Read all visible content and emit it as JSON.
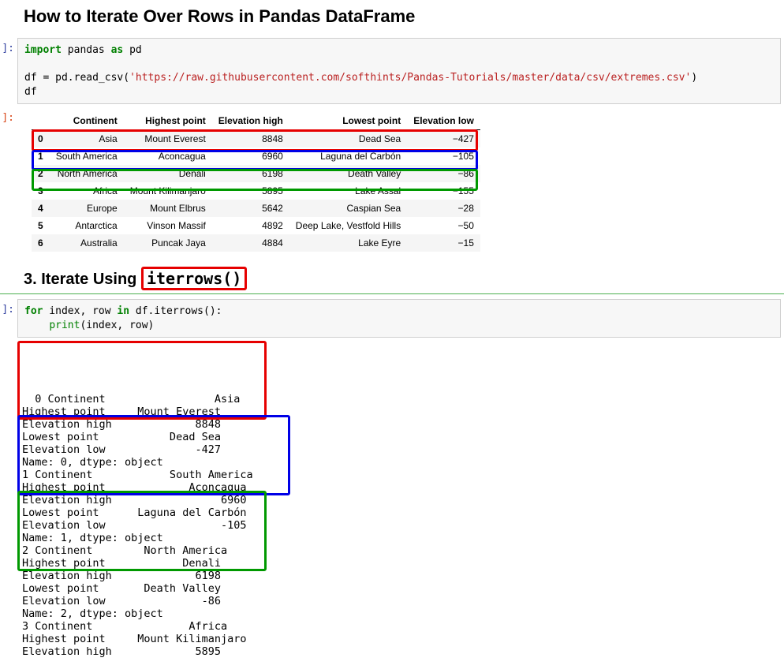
{
  "title": "How to Iterate Over Rows in Pandas DataFrame",
  "code1": {
    "import_kw": "import",
    "pandas": " pandas ",
    "as_kw": "as",
    "pd": " pd",
    "line2_a": "df ",
    "line2_eq": "=",
    "line2_b": " pd",
    "line2_dot": ".",
    "line2_fn": "read_csv(",
    "line2_str": "'https://raw.githubusercontent.com/softhints/Pandas-Tutorials/master/data/csv/extremes.csv'",
    "line2_cl": ")",
    "line3": "df"
  },
  "table": {
    "headers": [
      "",
      "Continent",
      "Highest point",
      "Elevation high",
      "Lowest point",
      "Elevation low"
    ],
    "rows": [
      [
        "0",
        "Asia",
        "Mount Everest",
        "8848",
        "Dead Sea",
        "−427"
      ],
      [
        "1",
        "South America",
        "Aconcagua",
        "6960",
        "Laguna del Carbón",
        "−105"
      ],
      [
        "2",
        "North America",
        "Denali",
        "6198",
        "Death Valley",
        "−86"
      ],
      [
        "3",
        "Africa",
        "Mount Kilimanjaro",
        "5895",
        "Lake Assal",
        "−155"
      ],
      [
        "4",
        "Europe",
        "Mount Elbrus",
        "5642",
        "Caspian Sea",
        "−28"
      ],
      [
        "5",
        "Antarctica",
        "Vinson Massif",
        "4892",
        "Deep Lake, Vestfold Hills",
        "−50"
      ],
      [
        "6",
        "Australia",
        "Puncak Jaya",
        "4884",
        "Lake Eyre",
        "−15"
      ]
    ]
  },
  "sub_heading": {
    "prefix": "3. Iterate Using ",
    "code": "iterrows()"
  },
  "code2": {
    "for_kw": "for",
    "mid": " index, row ",
    "in_kw": "in",
    "rest": " df",
    "dot": ".",
    "iter": "iterrows():",
    "indent": "    ",
    "print": "print",
    "args": "(index, row)"
  },
  "out_text": "0 Continent                 Asia\nHighest point     Mount Everest\nElevation high             8848\nLowest point           Dead Sea\nElevation low              -427\nName: 0, dtype: object\n1 Continent            South America\nHighest point             Aconcagua\nElevation high                 6960\nLowest point      Laguna del Carbón\nElevation low                  -105\nName: 1, dtype: object\n2 Continent        North America\nHighest point            Denali\nElevation high             6198\nLowest point       Death Valley\nElevation low               -86\nName: 2, dtype: object\n3 Continent               Africa\nHighest point     Mount Kilimanjaro\nElevation high             5895",
  "prompt_in": "]:",
  "prompt_out": "]:"
}
